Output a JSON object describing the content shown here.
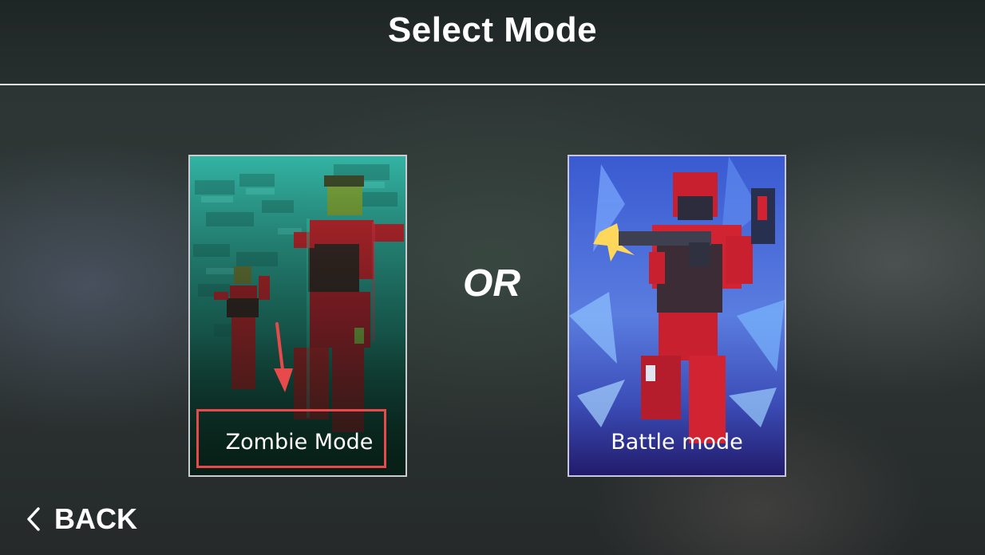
{
  "header": {
    "title": "Select Mode"
  },
  "modes": [
    {
      "label": "Zombie Mode",
      "image": "zombie-mode-art"
    },
    {
      "label": "Battle mode",
      "image": "battle-mode-art"
    }
  ],
  "separator": "OR",
  "back": {
    "label": "BACK",
    "icon": "chevron-left-icon"
  },
  "annotation": {
    "highlight_color": "#e8494a"
  },
  "colors": {
    "zombie_card_bg": "#2aa597",
    "battle_card_bg": "#4b5fc9",
    "soldier_red": "#c8202f"
  }
}
